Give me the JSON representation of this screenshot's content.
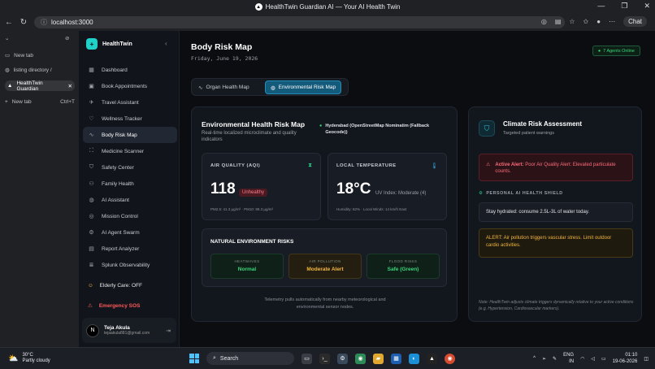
{
  "browser": {
    "window_title": "HealthTwin Guardian AI — Your AI Health Twin",
    "url": "localhost:3000",
    "chat_label": "Chat"
  },
  "tab_strip": {
    "new_tab_top": "New tab",
    "listing": "listing directory /",
    "active_tab": "HealthTwin Guardian",
    "new_tab": "New tab",
    "new_tab_shortcut": "Ctrl+T"
  },
  "app": {
    "brand": "HealthTwin",
    "nav": [
      {
        "label": "Dashboard",
        "icon": "grid-icon"
      },
      {
        "label": "Book Appointments",
        "icon": "calendar-icon"
      },
      {
        "label": "Travel Assistant",
        "icon": "plane-icon"
      },
      {
        "label": "Wellness Tracker",
        "icon": "heart-icon"
      },
      {
        "label": "Body Risk Map",
        "icon": "pulse-icon"
      },
      {
        "label": "Medicine Scanner",
        "icon": "scan-icon"
      },
      {
        "label": "Safety Center",
        "icon": "shield-icon"
      },
      {
        "label": "Family Health",
        "icon": "users-icon"
      },
      {
        "label": "AI Assistant",
        "icon": "globe-icon"
      },
      {
        "label": "Mission Control",
        "icon": "target-icon"
      },
      {
        "label": "AI Agent Swarm",
        "icon": "network-icon"
      },
      {
        "label": "Report Analyzer",
        "icon": "doc-icon"
      },
      {
        "label": "Splunk Observability",
        "icon": "database-icon"
      }
    ],
    "elderly": "Elderly Care: OFF",
    "sos": "Emergency SOS",
    "user": {
      "initial": "N",
      "name": "Teja Akula",
      "email": "tejaakula881@gmail.com"
    }
  },
  "page": {
    "title": "Body Risk Map",
    "date": "Friday, June 19, 2026",
    "agents": "7 Agents Online",
    "tabs": [
      "Organ Health Map",
      "Environmental Risk Map"
    ]
  },
  "env": {
    "title": "Environmental Health Risk Map",
    "subtitle": "Real-time localized microclimate and quality indicators",
    "location": "Hyderabad (OpenStreetMap Nominatim (Fallback Geocode))",
    "aqi": {
      "label": "AIR QUALITY (AQI)",
      "value": "118",
      "status": "Unhealthy",
      "note": "PM2.5: 41.3 µg/m³ · PM10: 88.3 µg/m³"
    },
    "temp": {
      "label": "LOCAL TEMPERATURE",
      "value": "18°C",
      "uv": "UV Index: Moderate (4)",
      "note": "Humidity: 82% · Local Winds: 14 km/h East"
    },
    "risks_title": "NATURAL ENVIRONMENT RISKS",
    "risks": [
      {
        "k": "HEATWAVES",
        "v": "Normal",
        "color": "#37d67a"
      },
      {
        "k": "AIR POLLUTION",
        "v": "Moderate Alert",
        "color": "#f2b640"
      },
      {
        "k": "FLOOD RISKS",
        "v": "Safe (Green)",
        "color": "#37d67a"
      }
    ],
    "telemetry": "Telemetry pulls automatically from nearby meteorological and environmental sensor nodes."
  },
  "climate": {
    "title": "Climate Risk Assessment",
    "subtitle": "Targeted patient warnings",
    "alert_bold": "Active Alert:",
    "alert_text": "Poor Air Quality Alert: Elevated particulate counts.",
    "shield_heading": "PERSONAL AI HEALTH SHIELD",
    "hydrate": "Stay hydrated: consume 2.5L-3L of water today.",
    "alert2": "ALERT: Air pollution triggers vascular stress. Limit outdoor cardio activities.",
    "note": "Note: HealthTwin adjusts climate triggers dynamically relative to your active conditions (e.g. Hypertension, Cardiovascular markers)."
  },
  "taskbar": {
    "temp": "30°C",
    "weather": "Partly cloudy",
    "search": "Search",
    "lang": "ENG",
    "region": "IN",
    "time": "01:10",
    "date": "19-06-2026"
  }
}
